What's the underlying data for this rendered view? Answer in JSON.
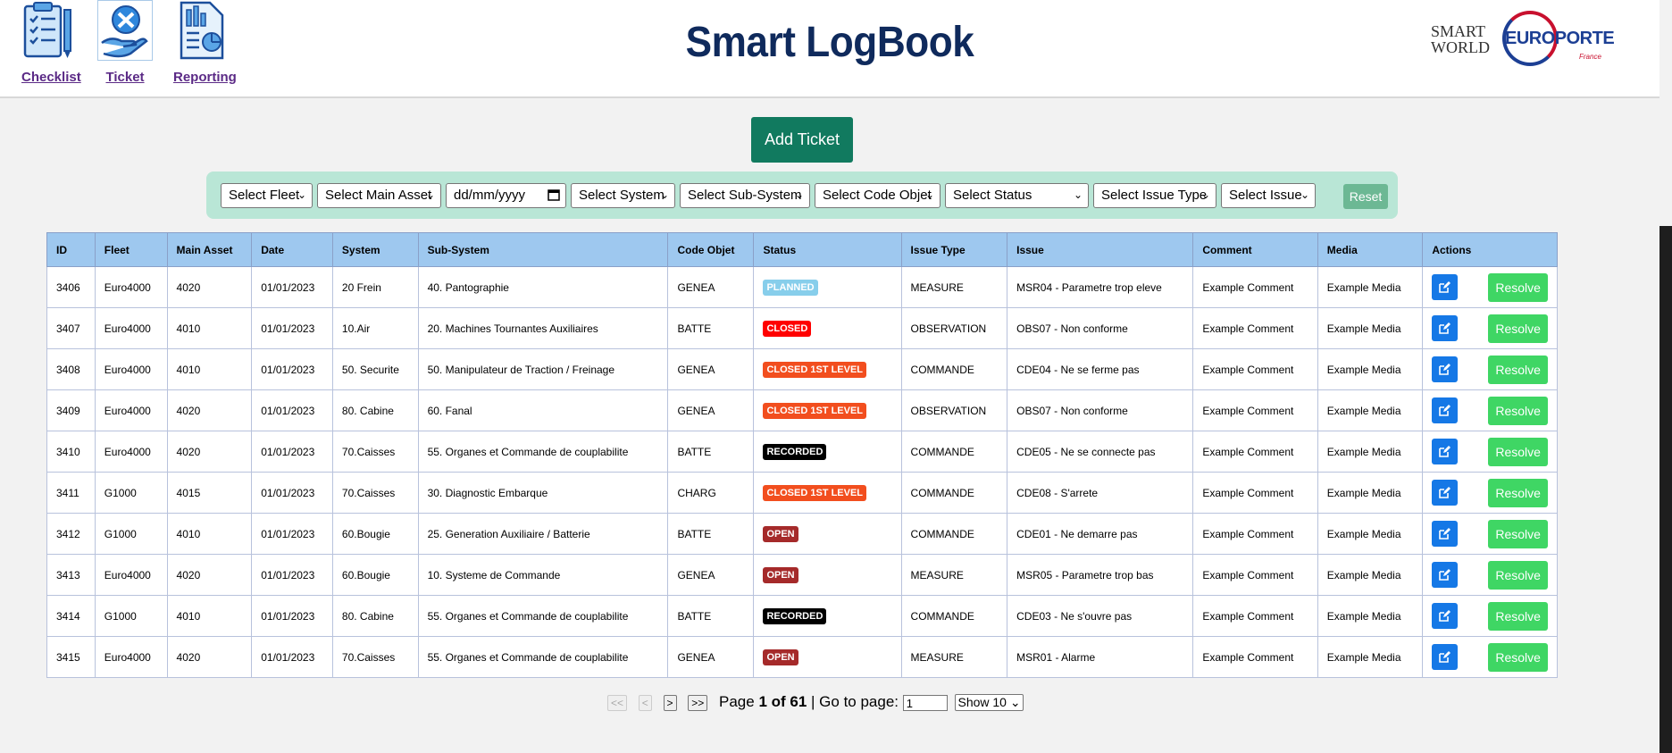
{
  "nav": [
    {
      "label": "Checklist",
      "icon": "checklist-icon"
    },
    {
      "label": "Ticket",
      "icon": "ticket-icon"
    },
    {
      "label": "Reporting",
      "icon": "reporting-icon"
    }
  ],
  "header": {
    "title": "Smart LogBook",
    "logo_smartworld_line1": "SMART",
    "logo_smartworld_line2": "WORLD",
    "logo_europorte": "EUROPORTE",
    "logo_europorte_sub": "France"
  },
  "actions": {
    "add_ticket": "Add Ticket",
    "reset": "Reset"
  },
  "filters": {
    "fleet": "Select Fleet",
    "main_asset": "Select Main Asset",
    "date": "dd/mm/yyyy",
    "system": "Select System",
    "sub_system": "Select Sub-System",
    "code_objet": "Select Code Objet",
    "status": "Select Status",
    "issue_type": "Select Issue Type",
    "issue": "Select Issue"
  },
  "table": {
    "headers": [
      "ID",
      "Fleet",
      "Main Asset",
      "Date",
      "System",
      "Sub-System",
      "Code Objet",
      "Status",
      "Issue Type",
      "Issue",
      "Comment",
      "Media",
      "Actions"
    ],
    "resolve_label": "Resolve",
    "status_colors": {
      "PLANNED": "#87ceeb",
      "CLOSED": "#ff0000",
      "CLOSED 1ST LEVEL": "#f24e1e",
      "RECORDED": "#000000",
      "OPEN": "#a52a2a"
    },
    "rows": [
      {
        "id": "3406",
        "fleet": "Euro4000",
        "main_asset": "4020",
        "date": "01/01/2023",
        "system": "20 Frein",
        "sub_system": "40. Pantographie",
        "code_objet": "GENEA",
        "status": "PLANNED",
        "issue_type": "MEASURE",
        "issue": "MSR04 - Parametre trop eleve",
        "comment": "Example Comment",
        "media": "Example Media"
      },
      {
        "id": "3407",
        "fleet": "Euro4000",
        "main_asset": "4010",
        "date": "01/01/2023",
        "system": "10.Air",
        "sub_system": "20. Machines Tournantes Auxiliaires",
        "code_objet": "BATTE",
        "status": "CLOSED",
        "issue_type": "OBSERVATION",
        "issue": "OBS07 - Non conforme",
        "comment": "Example Comment",
        "media": "Example Media"
      },
      {
        "id": "3408",
        "fleet": "Euro4000",
        "main_asset": "4010",
        "date": "01/01/2023",
        "system": "50. Securite",
        "sub_system": "50. Manipulateur de Traction / Freinage",
        "code_objet": "GENEA",
        "status": "CLOSED 1ST LEVEL",
        "issue_type": "COMMANDE",
        "issue": "CDE04 - Ne se ferme pas",
        "comment": "Example Comment",
        "media": "Example Media"
      },
      {
        "id": "3409",
        "fleet": "Euro4000",
        "main_asset": "4020",
        "date": "01/01/2023",
        "system": "80. Cabine",
        "sub_system": "60. Fanal",
        "code_objet": "GENEA",
        "status": "CLOSED 1ST LEVEL",
        "issue_type": "OBSERVATION",
        "issue": "OBS07 - Non conforme",
        "comment": "Example Comment",
        "media": "Example Media"
      },
      {
        "id": "3410",
        "fleet": "Euro4000",
        "main_asset": "4020",
        "date": "01/01/2023",
        "system": "70.Caisses",
        "sub_system": "55. Organes et Commande de couplabilite",
        "code_objet": "BATTE",
        "status": "RECORDED",
        "issue_type": "COMMANDE",
        "issue": "CDE05 - Ne se connecte pas",
        "comment": "Example Comment",
        "media": "Example Media"
      },
      {
        "id": "3411",
        "fleet": "G1000",
        "main_asset": "4015",
        "date": "01/01/2023",
        "system": "70.Caisses",
        "sub_system": "30. Diagnostic Embarque",
        "code_objet": "CHARG",
        "status": "CLOSED 1ST LEVEL",
        "issue_type": "COMMANDE",
        "issue": "CDE08 - S'arrete",
        "comment": "Example Comment",
        "media": "Example Media"
      },
      {
        "id": "3412",
        "fleet": "G1000",
        "main_asset": "4010",
        "date": "01/01/2023",
        "system": "60.Bougie",
        "sub_system": "25. Generation Auxiliaire / Batterie",
        "code_objet": "BATTE",
        "status": "OPEN",
        "issue_type": "COMMANDE",
        "issue": "CDE01 - Ne demarre pas",
        "comment": "Example Comment",
        "media": "Example Media"
      },
      {
        "id": "3413",
        "fleet": "Euro4000",
        "main_asset": "4020",
        "date": "01/01/2023",
        "system": "60.Bougie",
        "sub_system": "10. Systeme de Commande",
        "code_objet": "GENEA",
        "status": "OPEN",
        "issue_type": "MEASURE",
        "issue": "MSR05 - Parametre trop bas",
        "comment": "Example Comment",
        "media": "Example Media"
      },
      {
        "id": "3414",
        "fleet": "G1000",
        "main_asset": "4010",
        "date": "01/01/2023",
        "system": "80. Cabine",
        "sub_system": "55. Organes et Commande de couplabilite",
        "code_objet": "BATTE",
        "status": "RECORDED",
        "issue_type": "COMMANDE",
        "issue": "CDE03 - Ne s'ouvre pas",
        "comment": "Example Comment",
        "media": "Example Media"
      },
      {
        "id": "3415",
        "fleet": "Euro4000",
        "main_asset": "4020",
        "date": "01/01/2023",
        "system": "70.Caisses",
        "sub_system": "55. Organes et Commande de couplabilite",
        "code_objet": "GENEA",
        "status": "OPEN",
        "issue_type": "MEASURE",
        "issue": "MSR01 - Alarme",
        "comment": "Example Comment",
        "media": "Example Media"
      }
    ]
  },
  "pagination": {
    "first": "<<",
    "prev": "<",
    "next": ">",
    "last": ">>",
    "page_prefix": "Page",
    "page_info": "1 of 61",
    "goto_label": "| Go to page:",
    "goto_value": "1",
    "show": "Show 10"
  }
}
